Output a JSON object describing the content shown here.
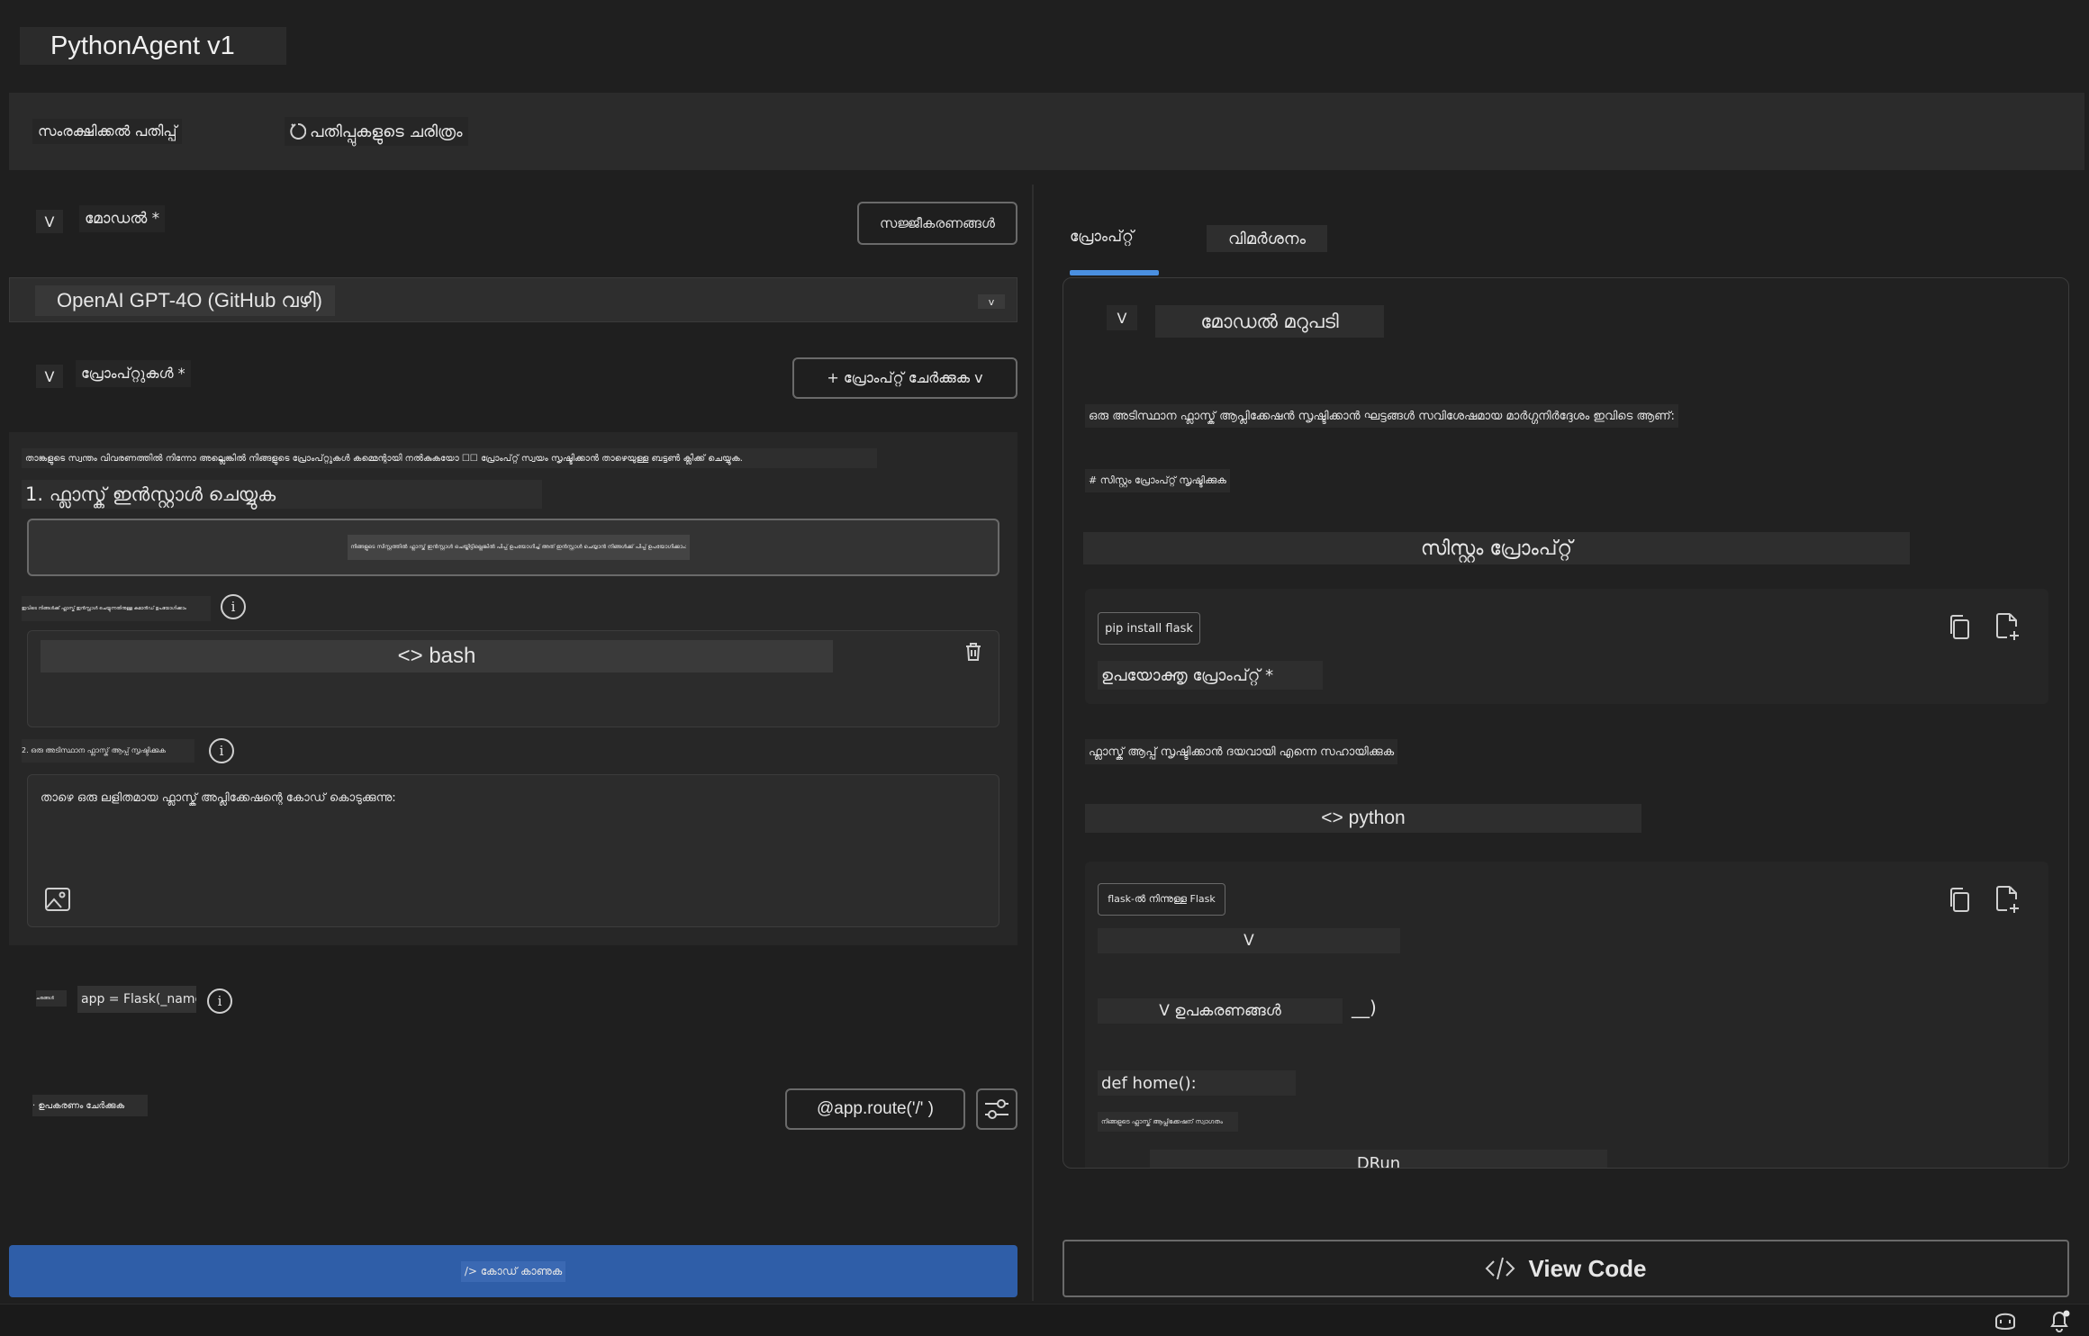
{
  "app": {
    "title": "PythonAgent v1"
  },
  "toolbar": {
    "save_version": "സംരക്ഷിക്കൽ പതിപ്പ്",
    "history": "പതിപ്പുകളുടെ ചരിത്രം"
  },
  "left": {
    "model_toggle": "V",
    "model_label": "മോഡൽ *",
    "settings_button": "സജ്ജീകരണങ്ങൾ",
    "model_select": {
      "value": "OpenAI GPT-4O (GitHub വഴി)",
      "caret": "v"
    },
    "prompts_toggle": "V",
    "prompts_label": "പ്രോംപ്റ്റുകൾ *",
    "add_prompt_button": "+ പ്രോംപ്റ്റ് ചേർക്കുക v",
    "prompt_hint": "താങ്കളുടെ സ്വന്തം വിവരണത്തിൽ നിന്നോ അല്ലെങ്കിൽ നിങ്ങളുടെ പ്രോംപ്റ്റുകൾ കമ്മെന്റായി നൽകുകയോ ☐☐ പ്രോംപ്റ്റ് സ്വയം സൃഷ്ടിക്കാൻ താഴെയുള്ള ബട്ടൺ ക്ലിക്ക് ചെയ്യുക.",
    "step1_heading": "1. ഫ്ലാസ്ക് ഇൻസ്റ്റാൾ ചെയ്യുക",
    "step1_box_text": "നിങ്ങളുടെ സിസ്റ്റത്തിൽ ഫ്ലാസ്ക് ഇൻസ്റ്റാൾ ചെയ്തിട്ടില്ലെങ്കിൽ പിപ്പ് ഉപയോഗിച്ച് അത് ഇൻസ്റ്റാൾ ചെയ്യാൻ നിങ്ങൾക്ക് പിപ്പ് ഉപയോഗിക്കാം:",
    "step1_sub_label": "ഇവിടെ നിങ്ങൾക്ക് ഫ്ലാസ്ക് ഇൻസ്റ്റാൾ ചെയ്യുന്നതിനുള്ള കമാൻഡ് ഉപയോഗിക്കാം",
    "bash_label": "<> bash",
    "step2_label": "2. ഒരു അടിസ്ഥാന ഫ്ലാസ്ക് ആപ്പ് സൃഷ്ടിക്കുക",
    "step2_text": "താഴെ ഒരു ലളിതമായ ഫ്ലാസ്ക് അപ്ലിക്കേഷന്റെ കോഡ് കൊടുക്കുന്നു:",
    "var_tag": "ചരങ്ങൾ",
    "var_value": "app = Flask(_name_",
    "add_tool": "· ഉപകരണം ചേർക്കുക",
    "route_button": "@app.route('/' )",
    "view_code_button": "/> കോഡ് കാണുക"
  },
  "right": {
    "tabs": [
      "പ്രോംപ്റ്റ്",
      "വിമർശനം"
    ],
    "response_toggle": "V",
    "response_title": "മോഡൽ മറുപടി",
    "intro": "ഒരു അടിസ്ഥാന ഫ്ലാസ്ക് ആപ്ലിക്കേഷൻ സൃഷ്ടിക്കാൻ ഘട്ടങ്ങൾ സവിശേഷമായ മാർഗ്ഗനിർദ്ദേശം ഇവിടെ ആണ്:",
    "comment_line": "# സിസ്റ്റം പ്രോംപ്റ്റ് സൃഷ്ടിക്കുക",
    "system_prompt_heading": "സിസ്റ്റം പ്രോംപ്റ്റ്",
    "code1_tag": "pip install flask",
    "user_prompt_label": "ഉപയോക്തൃ പ്രോംപ്റ്റ് *",
    "user_prompt_text": "ഫ്ലാസ്ക് ആപ്പ് സൃഷ്ടിക്കാൻ ദയവായി എന്നെ സഹായിക്കുക",
    "python_label": "<> python",
    "code2_tag": "flask-ൽ നിന്നുള്ള Flask",
    "code2_line1": "V",
    "code2_line2": "V ഉപകരണങ്ങൾ",
    "code2_paren": "__)",
    "code2_def": "def home():",
    "code2_return": "നിങ്ങളുടെ ഫ്ലാസ്ക് ആപ്ലിക്കേഷന് സ്വാഗതം",
    "code2_run": "DRun",
    "view_code_button": "View Code"
  },
  "icons": {
    "info": "info-icon",
    "trash": "trash-icon",
    "image": "image-icon",
    "copy": "copy-icon",
    "new_file": "new-file-icon",
    "sliders": "sliders-icon",
    "copilot": "copilot-icon",
    "bell": "bell-icon"
  },
  "colors": {
    "accent": "#2f5ea8",
    "tab_underline": "#4a8fe0",
    "background": "#1f1f1f"
  }
}
